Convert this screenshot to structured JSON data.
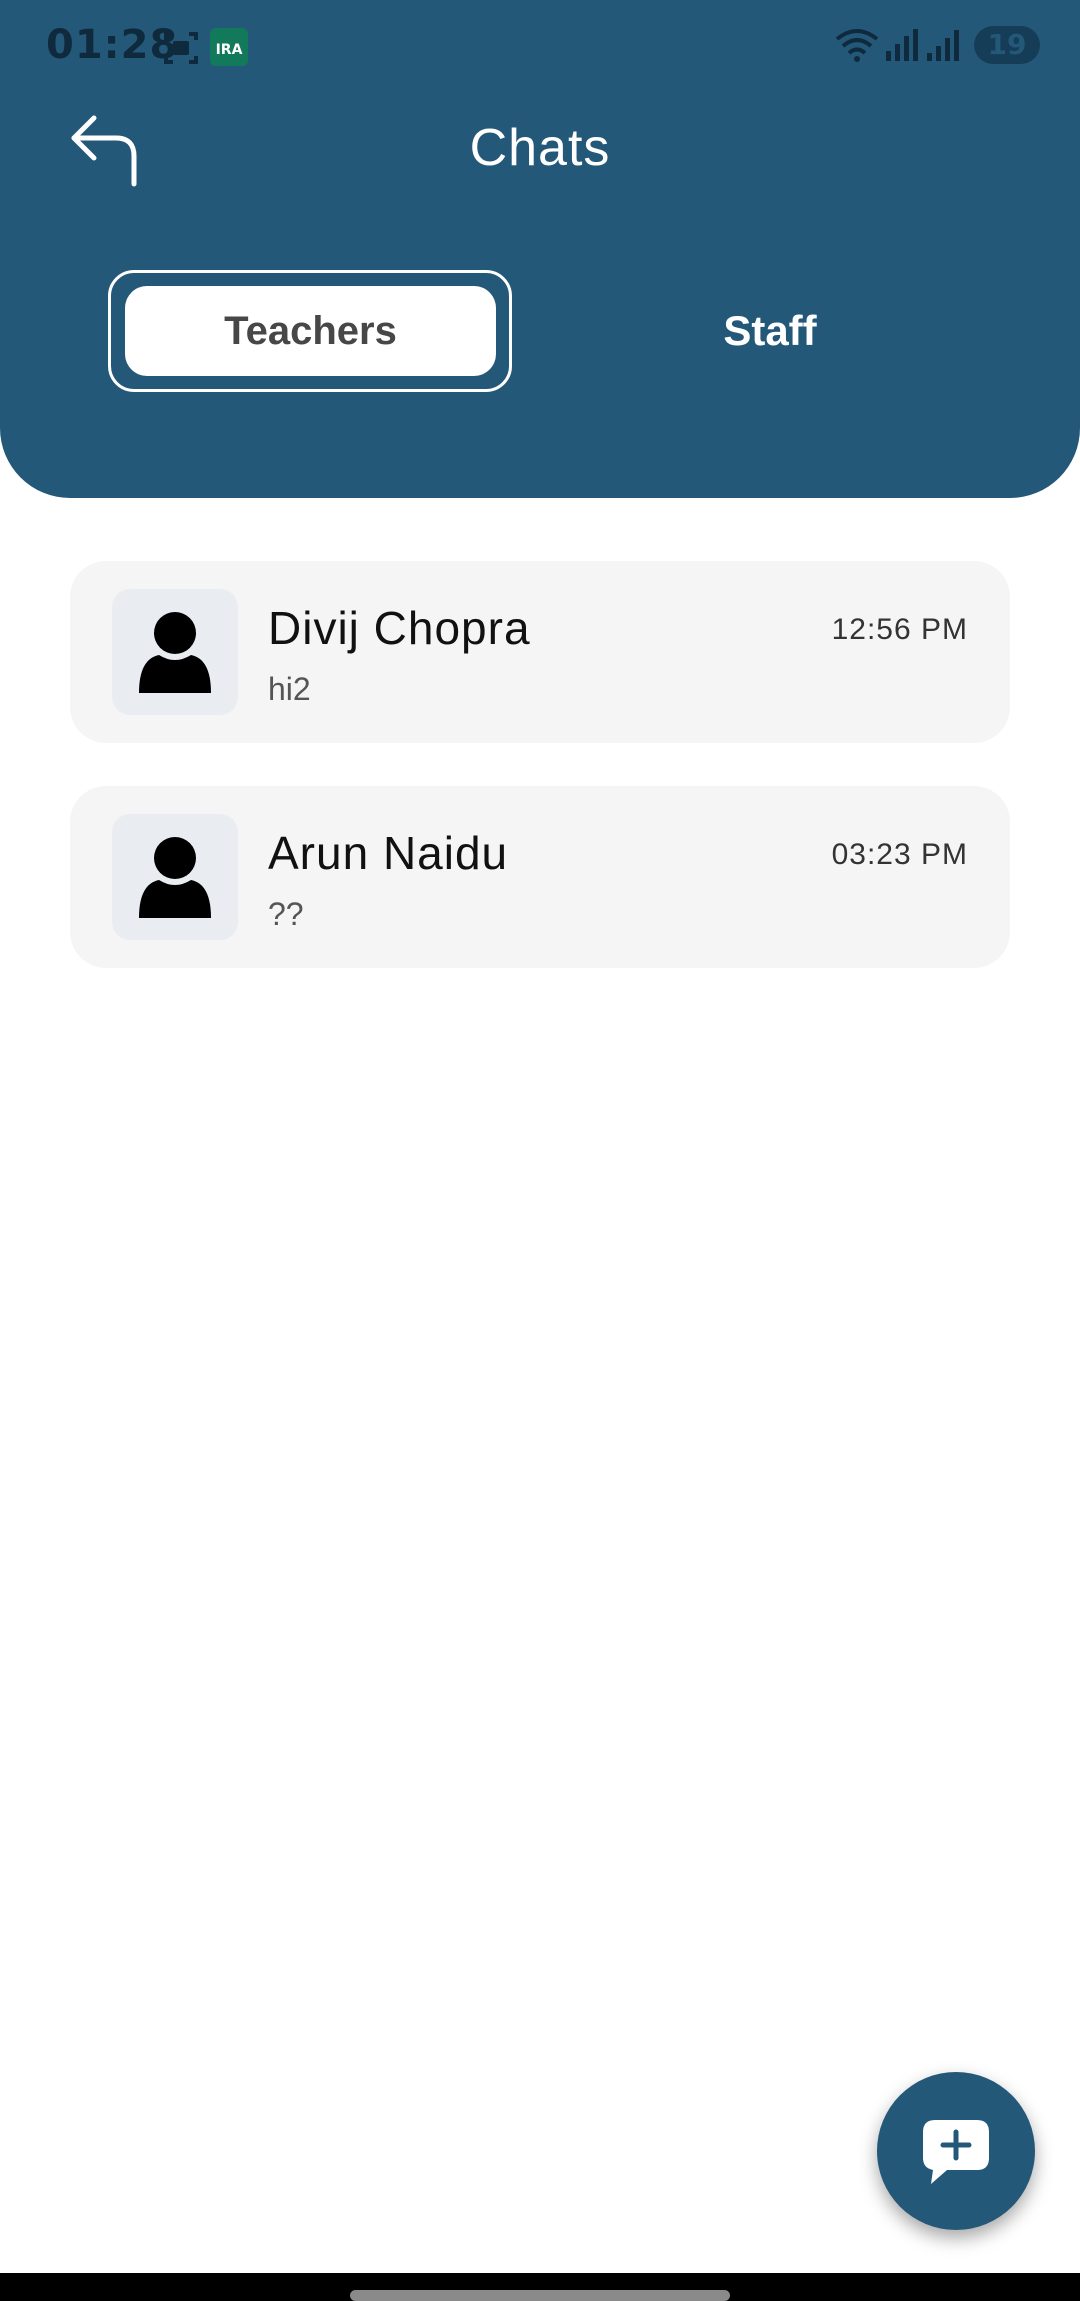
{
  "status_bar": {
    "time": "01:28",
    "app_badge": "IRA",
    "battery": "19"
  },
  "header": {
    "title": "Chats",
    "background_color": "#245879"
  },
  "tabs": [
    {
      "label": "Teachers",
      "selected": true
    },
    {
      "label": "Staff",
      "selected": false
    }
  ],
  "chats": [
    {
      "name": "Divij Chopra",
      "last_message": "hi2",
      "time": "12:56 PM"
    },
    {
      "name": "Arun Naidu",
      "last_message": "??",
      "time": "03:23 PM"
    }
  ],
  "fab": {
    "icon": "new-chat-plus-icon"
  }
}
